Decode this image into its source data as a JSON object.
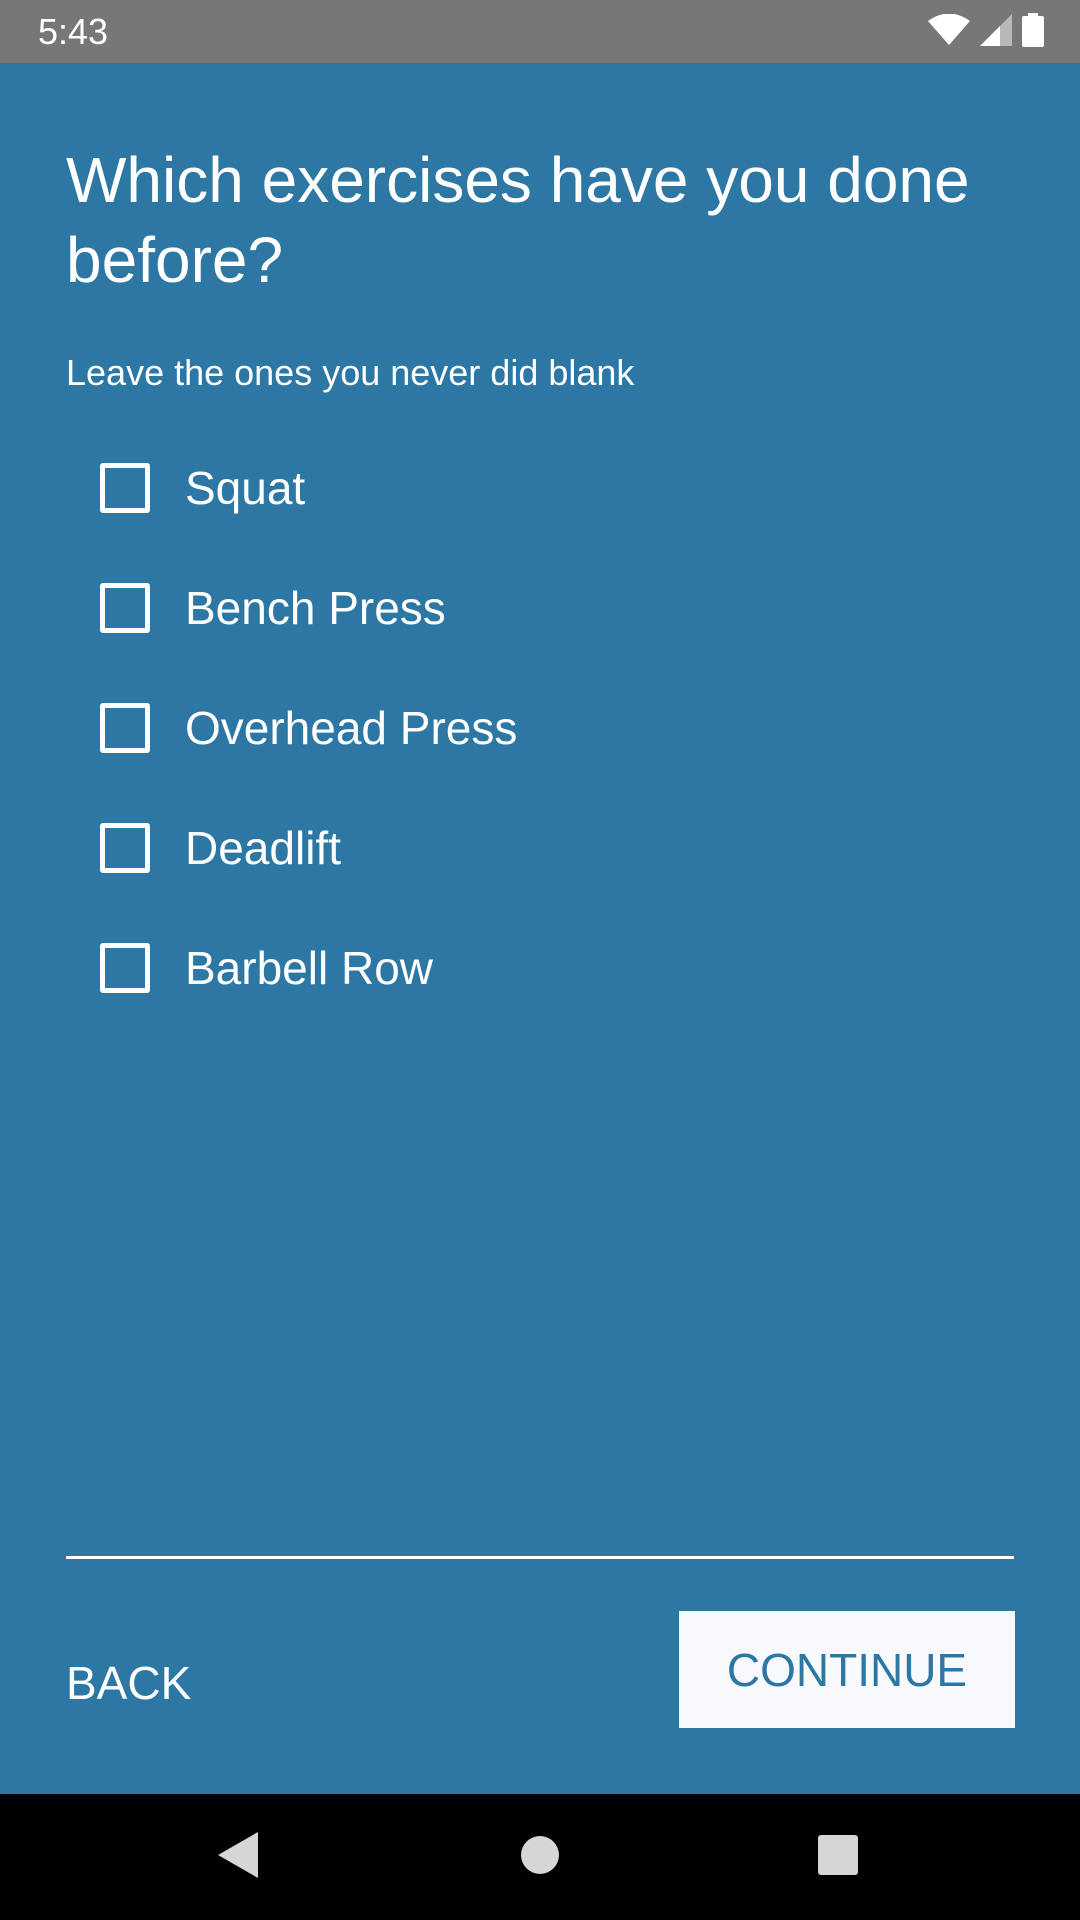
{
  "status_bar": {
    "time": "5:43",
    "icons": [
      "wifi-icon",
      "cell-signal-icon",
      "battery-icon"
    ]
  },
  "screen": {
    "title": "Which exercises have you done before?",
    "subtitle": "Leave the ones you never did blank",
    "options": [
      {
        "label": "Squat",
        "checked": false
      },
      {
        "label": "Bench Press",
        "checked": false
      },
      {
        "label": "Overhead Press",
        "checked": false
      },
      {
        "label": "Deadlift",
        "checked": false
      },
      {
        "label": "Barbell Row",
        "checked": false
      }
    ]
  },
  "footer": {
    "back_label": "BACK",
    "continue_label": "CONTINUE"
  },
  "nav_bar": {
    "icons": [
      "back-triangle-icon",
      "home-circle-icon",
      "recents-square-icon"
    ]
  },
  "colors": {
    "background": "#2c77a4",
    "status_bar": "#777777",
    "continue_bg": "#f7f9fc",
    "nav_bar": "#000000"
  }
}
